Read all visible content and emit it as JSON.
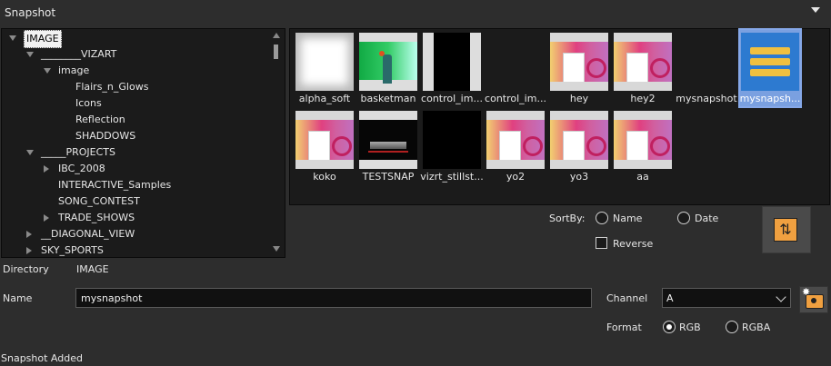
{
  "panel": {
    "title": "Snapshot"
  },
  "tree": {
    "items": [
      {
        "label": "IMAGE",
        "state": "expanded",
        "depth": 0,
        "selected": true
      },
      {
        "label": "________VIZART",
        "state": "expanded",
        "depth": 1
      },
      {
        "label": "image",
        "state": "expanded",
        "depth": 2
      },
      {
        "label": "Flairs_n_Glows",
        "state": "leaf",
        "depth": 3
      },
      {
        "label": "Icons",
        "state": "leaf",
        "depth": 3
      },
      {
        "label": "Reflection",
        "state": "leaf",
        "depth": 3
      },
      {
        "label": "SHADDOWS",
        "state": "leaf",
        "depth": 3
      },
      {
        "label": "_____PROJECTS",
        "state": "expanded",
        "depth": 1
      },
      {
        "label": "IBC_2008",
        "state": "collapsed",
        "depth": 2
      },
      {
        "label": "INTERACTIVE_Samples",
        "state": "leaf",
        "depth": 2
      },
      {
        "label": "SONG_CONTEST",
        "state": "leaf",
        "depth": 2
      },
      {
        "label": "TRADE_SHOWS",
        "state": "collapsed",
        "depth": 2
      },
      {
        "label": "__DIAGONAL_VIEW",
        "state": "collapsed",
        "depth": 1
      },
      {
        "label": "SKY_SPORTS",
        "state": "collapsed",
        "depth": 1
      }
    ]
  },
  "gallery": {
    "items": [
      {
        "label": "alpha_soft",
        "kind": "white"
      },
      {
        "label": "basketman",
        "kind": "green"
      },
      {
        "label": "control_im...",
        "kind": "black-center"
      },
      {
        "label": "control_im...",
        "kind": "blank"
      },
      {
        "label": "hey",
        "kind": "magenta"
      },
      {
        "label": "hey2",
        "kind": "magenta"
      },
      {
        "label": "mysnapshot",
        "kind": "blank"
      },
      {
        "label": "mysnapsh...",
        "kind": "mysnap",
        "selected": true
      },
      {
        "label": "koko",
        "kind": "magenta"
      },
      {
        "label": "TESTSNAP",
        "kind": "test"
      },
      {
        "label": "vizrt_stillst...",
        "kind": "black"
      },
      {
        "label": "yo2",
        "kind": "magenta"
      },
      {
        "label": "yo3",
        "kind": "magenta"
      },
      {
        "label": "aa",
        "kind": "magenta"
      }
    ]
  },
  "sort": {
    "label": "SortBy:",
    "name_label": "Name",
    "date_label": "Date",
    "reverse_label": "Reverse",
    "selected": "none",
    "reverse_checked": false
  },
  "refresh_icon": "refresh-icon",
  "directory": {
    "label": "Directory",
    "value": "IMAGE"
  },
  "name_field": {
    "label": "Name",
    "value": "mysnapshot"
  },
  "channel": {
    "label": "Channel",
    "value": "A"
  },
  "format": {
    "label": "Format",
    "rgb_label": "RGB",
    "rgba_label": "RGBA",
    "selected": "RGB"
  },
  "snapshot_button_icon": "camera-icon",
  "status": {
    "text": "Snapshot Added"
  },
  "colors": {
    "accent_selection": "#7aa0e0",
    "button_orange": "#f0a040",
    "panel_bg": "#2d2d2d",
    "well_bg": "#1b1b1b"
  }
}
